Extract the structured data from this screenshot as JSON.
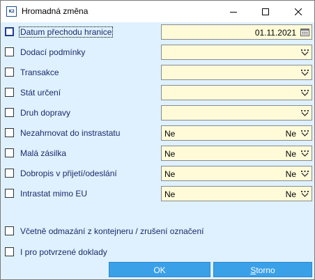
{
  "window": {
    "title": "Hromadná změna",
    "icon_text": "K2"
  },
  "rows": [
    {
      "label": "Datum přechodu hranice",
      "value": "01.11.2021",
      "icon": "calendar-icon",
      "focused": true
    },
    {
      "label": "Dodací podmínky",
      "value": "",
      "icon": "dropdown-icon"
    },
    {
      "label": "Transakce",
      "value": "",
      "icon": "dropdown-icon"
    },
    {
      "label": "Stát určení",
      "value": "",
      "icon": "dropdown-icon"
    },
    {
      "label": "Druh dopravy",
      "value": "",
      "icon": "dropdown-icon"
    },
    {
      "label": "Nezahrnovat do instrastatu",
      "value": "Ne",
      "value_right": "Ne",
      "icon": "dropdown-icon"
    },
    {
      "label": "Malá zásilka",
      "value": "Ne",
      "value_right": "Ne",
      "icon": "dropdown-icon"
    },
    {
      "label": "Dobropis v přijetí/odeslání",
      "value": "Ne",
      "value_right": "Ne",
      "icon": "dropdown-icon"
    },
    {
      "label": "Intrastat mimo EU",
      "value": "Ne",
      "value_right": "Ne",
      "icon": "dropdown-icon"
    }
  ],
  "options": [
    {
      "label": "Včetně odmazání z kontejneru / zrušení označení"
    },
    {
      "label": "I pro potvrzené doklady"
    }
  ],
  "buttons": {
    "ok": "OK",
    "cancel_underlined": "S",
    "cancel_rest": "torno"
  },
  "colors": {
    "background": "#dff1ff",
    "field": "#fffbd9",
    "button": "#3aa0e8",
    "label": "#1a2a6a"
  }
}
